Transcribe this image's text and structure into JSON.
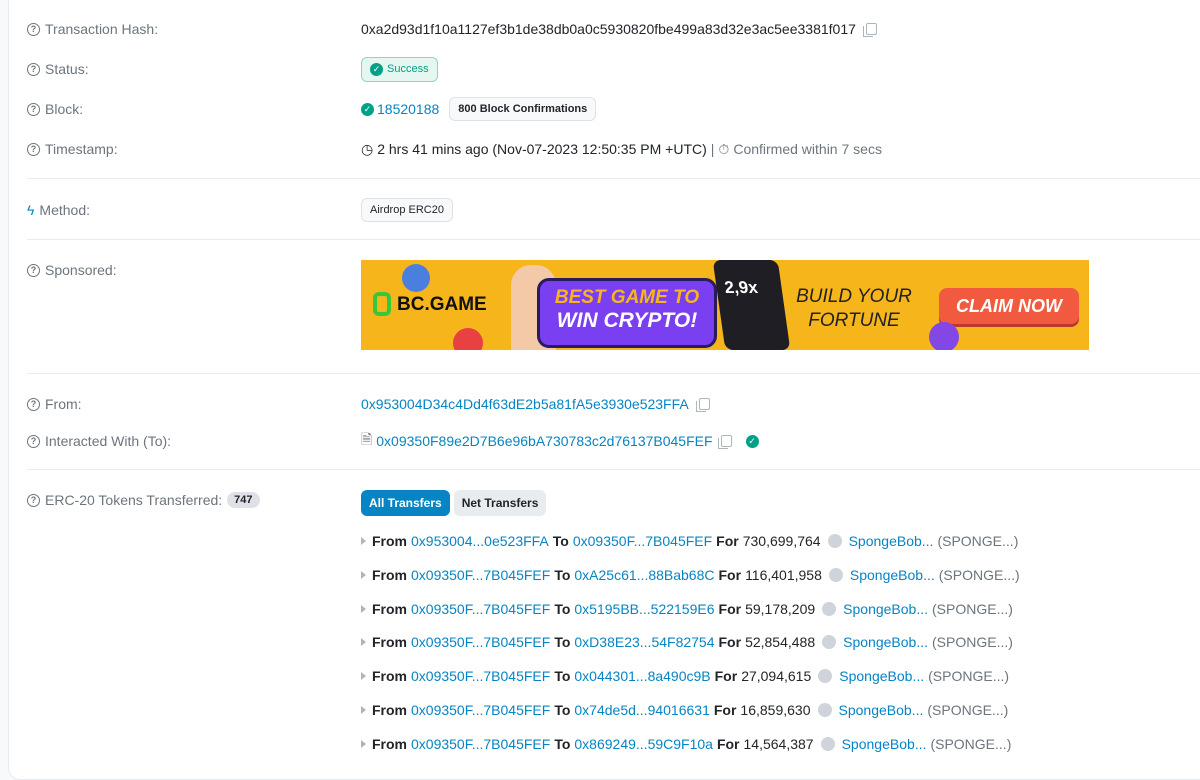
{
  "labels": {
    "hash": "Transaction Hash:",
    "status": "Status:",
    "block": "Block:",
    "timestamp": "Timestamp:",
    "method": "Method:",
    "sponsored": "Sponsored:",
    "from": "From:",
    "to": "Interacted With (To):",
    "erc20": "ERC-20 Tokens Transferred:"
  },
  "tx": {
    "hash": "0xa2d93d1f10a1127ef3b1de38db0a0c5930820fbe499a83d32e3ac5ee3381f017",
    "status": "Success",
    "block": "18520188",
    "confirmations": "800 Block Confirmations",
    "time_ago": "2 hrs 41 mins ago (Nov-07-2023 12:50:35 PM +UTC)",
    "separator": "|",
    "confirmed": "Confirmed within 7 secs",
    "method": "Airdrop ERC20",
    "from": "0x953004D34c4Dd4f63dE2b5a81fA5e3930e523FFA",
    "to": "0x09350F89e2D7B6e96bA730783c2d76137B045FEF",
    "erc20_count": "747"
  },
  "banner": {
    "brand": "BC.GAME",
    "headline1": "BEST GAME TO",
    "headline2": "WIN CRYPTO!",
    "multiplier": "2,9x",
    "tagline1": "BUILD YOUR",
    "tagline2": "FORTUNE",
    "cta": "CLAIM NOW"
  },
  "tabs": {
    "all": "All Transfers",
    "net": "Net Transfers"
  },
  "words": {
    "from": "From",
    "to": "To",
    "for": "For"
  },
  "transfers": [
    {
      "from": "0x953004...0e523FFA",
      "to": "0x09350F...7B045FEF",
      "amount": "730,699,764",
      "token": "SpongeBob...",
      "symbol": "(SPONGE...)"
    },
    {
      "from": "0x09350F...7B045FEF",
      "to": "0xA25c61...88Bab68C",
      "amount": "116,401,958",
      "token": "SpongeBob...",
      "symbol": "(SPONGE...)"
    },
    {
      "from": "0x09350F...7B045FEF",
      "to": "0x5195BB...522159E6",
      "amount": "59,178,209",
      "token": "SpongeBob...",
      "symbol": "(SPONGE...)"
    },
    {
      "from": "0x09350F...7B045FEF",
      "to": "0xD38E23...54F82754",
      "amount": "52,854,488",
      "token": "SpongeBob...",
      "symbol": "(SPONGE...)"
    },
    {
      "from": "0x09350F...7B045FEF",
      "to": "0x044301...8a490c9B",
      "amount": "27,094,615",
      "token": "SpongeBob...",
      "symbol": "(SPONGE...)"
    },
    {
      "from": "0x09350F...7B045FEF",
      "to": "0x74de5d...94016631",
      "amount": "16,859,630",
      "token": "SpongeBob...",
      "symbol": "(SPONGE...)"
    },
    {
      "from": "0x09350F...7B045FEF",
      "to": "0x869249...59C9F10a",
      "amount": "14,564,387",
      "token": "SpongeBob...",
      "symbol": "(SPONGE...)"
    }
  ]
}
